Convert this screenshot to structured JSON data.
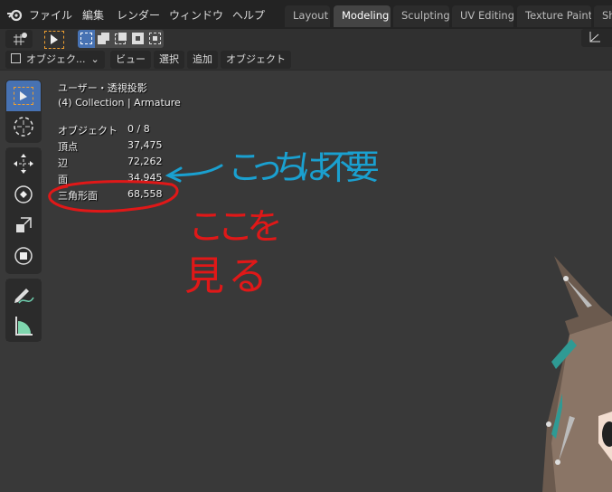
{
  "menu": [
    "ファイル",
    "編集",
    "レンダー",
    "ウィンドウ",
    "ヘルプ"
  ],
  "tabs": [
    "Layout",
    "Modeling",
    "Sculpting",
    "UV Editing",
    "Texture Paint",
    "Sh"
  ],
  "active_tab": "Modeling",
  "header": {
    "mode": "オブジェク...",
    "view": "ビュー",
    "select": "選択",
    "add": "追加",
    "object": "オブジェクト"
  },
  "overlay": {
    "view_name": "ユーザー・透視投影",
    "collection": "(4) Collection | Armature",
    "stats": [
      {
        "label": "オブジェクト",
        "value": "0 / 8"
      },
      {
        "label": "頂点",
        "value": "37,475"
      },
      {
        "label": "辺",
        "value": "72,262"
      },
      {
        "label": "面",
        "value": "34,945"
      },
      {
        "label": "三角形面",
        "value": "68,558"
      }
    ]
  },
  "annotations": {
    "blue_note": "こっちは不要",
    "red_note_1": "ここを",
    "red_note_2": "見る",
    "blue": "#1aa0d0",
    "red": "#e01818"
  },
  "colors": {
    "accent": "#4772b3",
    "select_outline": "#f0a030"
  }
}
